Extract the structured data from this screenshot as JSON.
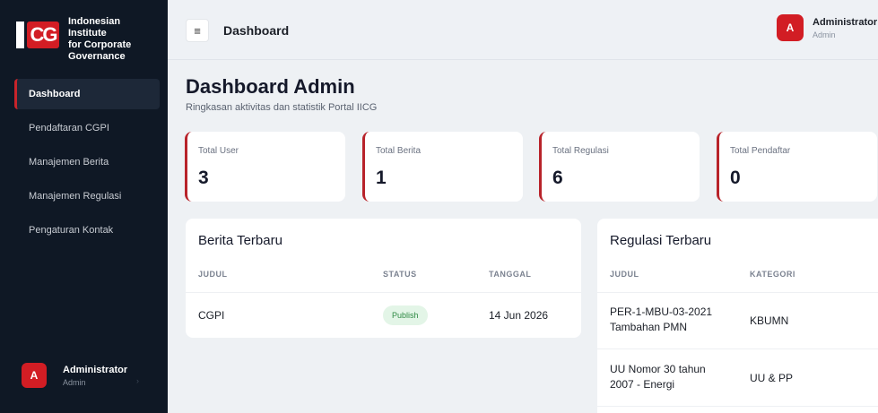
{
  "sidebar": {
    "brand": [
      "Indonesian Institute",
      "for Corporate",
      "Governance"
    ],
    "logo_text": "CG",
    "items": [
      {
        "label": "Dashboard"
      },
      {
        "label": "Pendaftaran CGPI"
      },
      {
        "label": "Manajemen Berita"
      },
      {
        "label": "Manajemen Regulasi"
      },
      {
        "label": "Pengaturan Kontak"
      }
    ],
    "user": {
      "initial": "A",
      "name": "Administrator",
      "role": "Admin"
    }
  },
  "header": {
    "menu_icon": "≡",
    "title": "Dashboard",
    "user": {
      "initial": "A",
      "name": "Administrator",
      "role": "Admin"
    }
  },
  "main": {
    "title": "Dashboard Admin",
    "subtitle": "Ringkasan aktivitas dan statistik Portal IICG",
    "stats": [
      {
        "label": "Total User",
        "value": "3"
      },
      {
        "label": "Total Berita",
        "value": "1"
      },
      {
        "label": "Total Regulasi",
        "value": "6"
      },
      {
        "label": "Total Pendaftar",
        "value": "0"
      }
    ],
    "berita": {
      "title": "Berita Terbaru",
      "columns": [
        "JUDUL",
        "STATUS",
        "TANGGAL"
      ],
      "rows": [
        {
          "judul": "CGPI",
          "status": "Publish",
          "tanggal": "14 Jun 2026"
        }
      ]
    },
    "regulasi": {
      "title": "Regulasi Terbaru",
      "columns": [
        "JUDUL",
        "KATEGORI"
      ],
      "rows": [
        {
          "judul": [
            "PER-1-MBU-03-2021",
            "Tambahan PMN"
          ],
          "kategori": "KBUMN"
        },
        {
          "judul": [
            "UU Nomor 30 tahun",
            "2007 - Energi"
          ],
          "kategori": "UU & PP"
        }
      ]
    }
  },
  "colors": {
    "accent": "#d21d24",
    "sidebar": "#0f1825",
    "badge_bg": "#e3f5e7",
    "badge_fg": "#2f8a44"
  }
}
